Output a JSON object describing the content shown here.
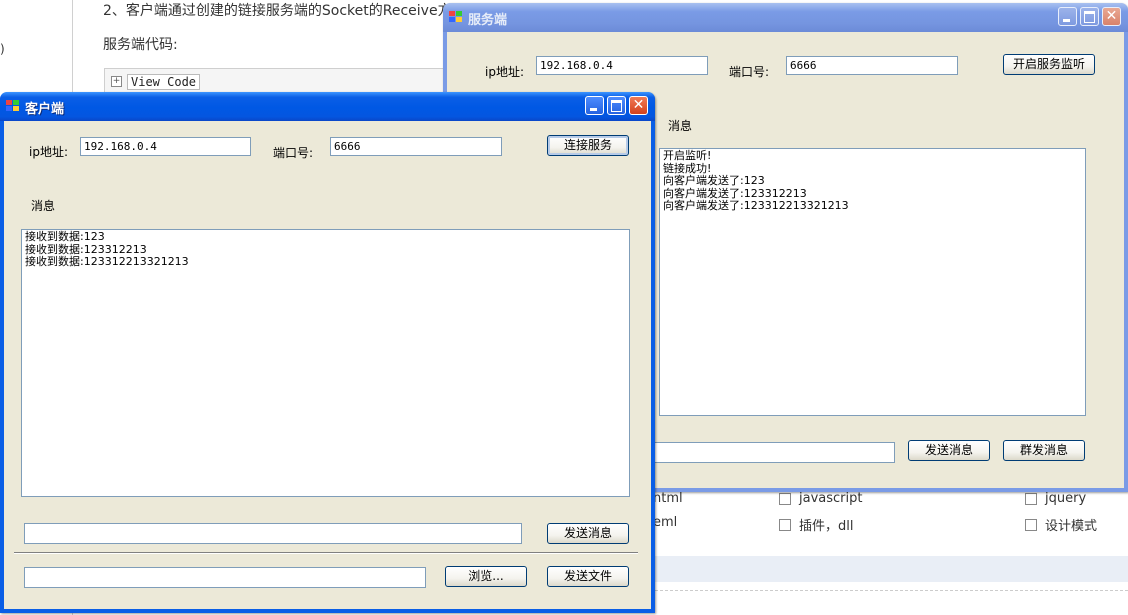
{
  "background_page": {
    "paren": ")",
    "intro_text": "2、客户端通过创建的链接服务端的Socket的Receive方",
    "server_code_label": "服务端代码:",
    "view_code_label": "View Code",
    "checkbox_col1": [
      "ntml",
      "eml"
    ],
    "checkbox_col2": [
      "javascript",
      "插件，dll"
    ],
    "checkbox_col3": [
      "jquery",
      "设计模式"
    ]
  },
  "server_window": {
    "title": "服务端",
    "ip_label": "ip地址:",
    "ip_value": "192.168.0.4",
    "port_label": "端口号:",
    "port_value": "6666",
    "listen_button": "开启服务监听",
    "message_label": "消息",
    "messages": [
      "开启监听!",
      "链接成功!",
      "向客户端发送了:123",
      "向客户端发送了:123312213",
      "向客户端发送了:123312213321213"
    ],
    "send_input_value": "",
    "send_button": "发送消息",
    "broadcast_button": "群发消息"
  },
  "client_window": {
    "title": "客户端",
    "ip_label": "ip地址:",
    "ip_value": "192.168.0.4",
    "port_label": "端口号:",
    "port_value": "6666",
    "connect_button": "连接服务",
    "message_label": "消息",
    "messages": [
      "接收到数据:123",
      "接收到数据:123312213",
      "接收到数据:123312213321213"
    ],
    "send_input_value": "",
    "send_button": "发送消息",
    "file_input_value": "",
    "browse_button": "浏览...",
    "send_file_button": "发送文件"
  }
}
